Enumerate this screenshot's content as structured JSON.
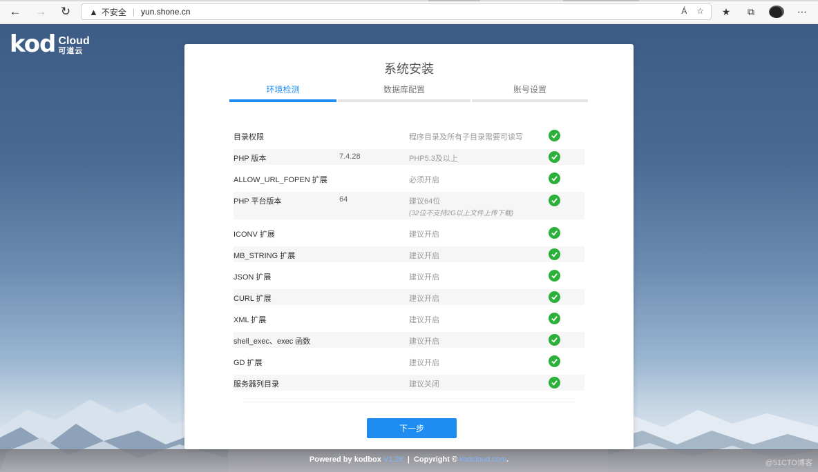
{
  "browser": {
    "security_label": "不安全",
    "url": "yun.shone.cn"
  },
  "logo": {
    "brand": "kod",
    "cloud": "Cloud",
    "cn": "可道云"
  },
  "install": {
    "title": "系统安装",
    "steps": [
      {
        "label": "环境检测",
        "active": true
      },
      {
        "label": "数据库配置",
        "active": false
      },
      {
        "label": "账号设置",
        "active": false
      }
    ],
    "checks": [
      {
        "name": "目录权限",
        "value": "",
        "requirement": "程序目录及所有子目录需要可读写",
        "note": "",
        "ok": true
      },
      {
        "name": "PHP 版本",
        "value": "7.4.28",
        "requirement": "PHP5.3及以上",
        "note": "",
        "ok": true
      },
      {
        "name": "ALLOW_URL_FOPEN 扩展",
        "value": "",
        "requirement": "必须开启",
        "note": "",
        "ok": true
      },
      {
        "name": "PHP 平台版本",
        "value": "64",
        "requirement": "建议64位",
        "note": "(32位不支持2G以上文件上传下载)",
        "ok": true
      },
      {
        "name": "ICONV 扩展",
        "value": "",
        "requirement": "建议开启",
        "note": "",
        "ok": true
      },
      {
        "name": "MB_STRING 扩展",
        "value": "",
        "requirement": "建议开启",
        "note": "",
        "ok": true
      },
      {
        "name": "JSON 扩展",
        "value": "",
        "requirement": "建议开启",
        "note": "",
        "ok": true
      },
      {
        "name": "CURL 扩展",
        "value": "",
        "requirement": "建议开启",
        "note": "",
        "ok": true
      },
      {
        "name": "XML 扩展",
        "value": "",
        "requirement": "建议开启",
        "note": "",
        "ok": true
      },
      {
        "name": "shell_exec、exec 函数",
        "value": "",
        "requirement": "建议开启",
        "note": "",
        "ok": true
      },
      {
        "name": "GD 扩展",
        "value": "",
        "requirement": "建议开启",
        "note": "",
        "ok": true
      },
      {
        "name": "服务器列目录",
        "value": "",
        "requirement": "建议关闭",
        "note": "",
        "ok": true
      }
    ],
    "next_label": "下一步"
  },
  "footer": {
    "powered": "Powered by kodbox",
    "version": "V1.28",
    "sep": "|",
    "copyright": "Copyright ©",
    "link": "kodcloud.com",
    "tail": "."
  },
  "watermark": "@51CTO博客",
  "colors": {
    "accent": "#1e8cf0",
    "ok": "#2bb03a"
  }
}
